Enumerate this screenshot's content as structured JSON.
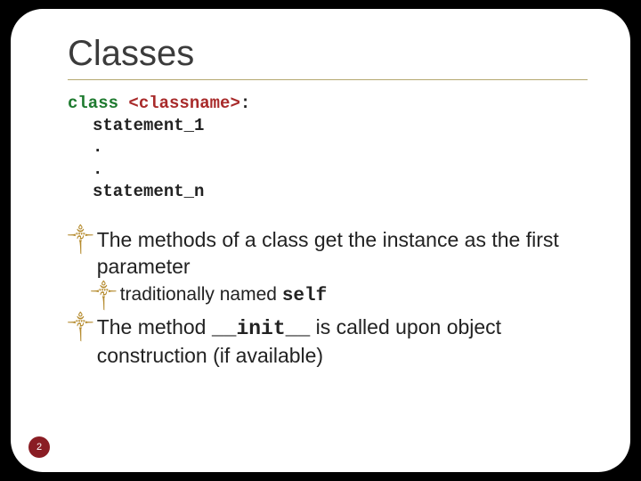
{
  "title": "Classes",
  "code": {
    "kw_class": "class",
    "classname": "<classname>",
    "colon": ":",
    "stmt1": "statement_1",
    "dot1": ".",
    "dot2": ".",
    "stmtn": "statement_n"
  },
  "bullets": {
    "b1": "The methods of a class get the instance as the first parameter",
    "b1_sub_pre": "traditionally named ",
    "b1_sub_code": "self",
    "b2_pre": "The method ",
    "b2_code": "__init__",
    "b2_post": " is called upon object construction (if available)"
  },
  "page": "2",
  "glyphs": {
    "swash": "༒"
  }
}
